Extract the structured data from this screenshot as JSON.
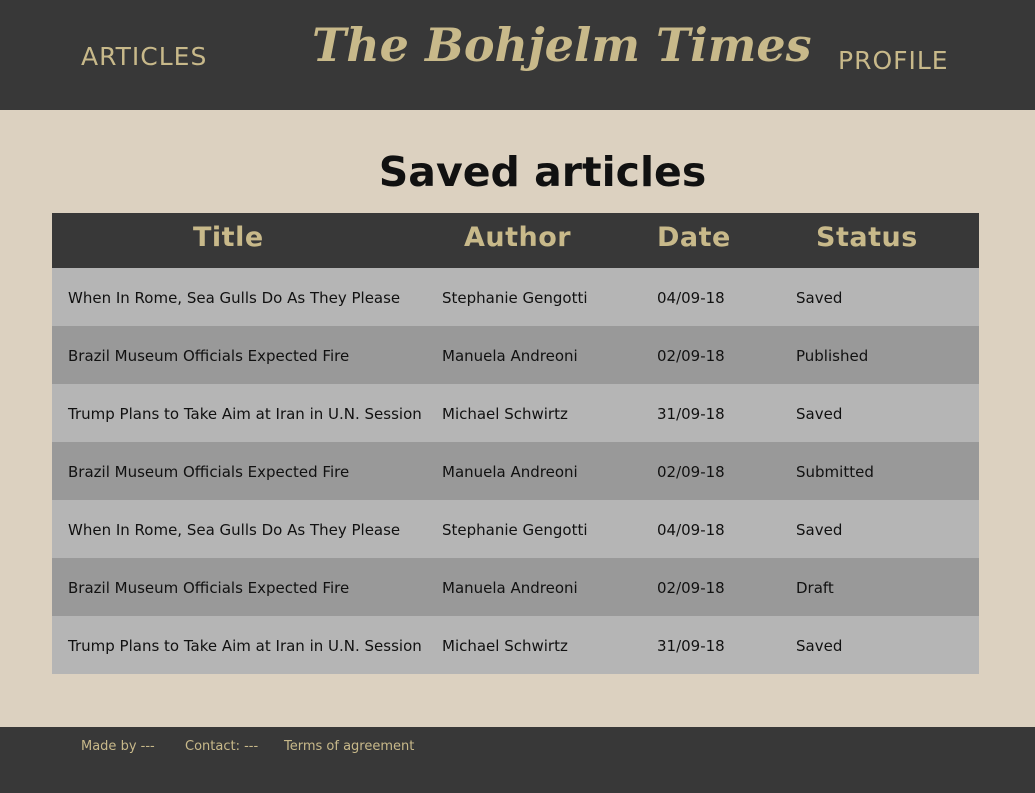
{
  "header": {
    "nav_articles": "ARTICLES",
    "logo": "The Bohjelm Times",
    "nav_profile": "PROFILE"
  },
  "main": {
    "title": "Saved articles",
    "columns": [
      "Title",
      "Author",
      "Date",
      "Status"
    ],
    "rows": [
      {
        "title": "When In Rome, Sea Gulls Do As They Please",
        "author": "Stephanie Gengotti",
        "date": "04/09-18",
        "status": "Saved"
      },
      {
        "title": "Brazil Museum Officials Expected Fire",
        "author": "Manuela Andreoni",
        "date": "02/09-18",
        "status": "Published"
      },
      {
        "title": "Trump Plans to Take Aim at Iran in U.N. Session",
        "author": "Michael Schwirtz",
        "date": "31/09-18",
        "status": "Saved"
      },
      {
        "title": "Brazil Museum Officials Expected Fire",
        "author": "Manuela Andreoni",
        "date": "02/09-18",
        "status": "Submitted"
      },
      {
        "title": "When In Rome, Sea Gulls Do As They Please",
        "author": "Stephanie Gengotti",
        "date": "04/09-18",
        "status": "Saved"
      },
      {
        "title": "Brazil Museum Officials Expected Fire",
        "author": "Manuela Andreoni",
        "date": "02/09-18",
        "status": "Draft"
      },
      {
        "title": "Trump Plans to Take Aim at Iran in U.N. Session",
        "author": "Michael Schwirtz",
        "date": "31/09-18",
        "status": "Saved"
      }
    ]
  },
  "footer": {
    "made_by": "Made by ---",
    "contact": "Contact: ---",
    "terms": "Terms of agreement"
  },
  "colors": {
    "header_bg": "#383838",
    "accent": "#c8b98a",
    "page_bg": "#dcd1c0",
    "row_light": "#b5b5b5",
    "row_dark": "#999999"
  }
}
